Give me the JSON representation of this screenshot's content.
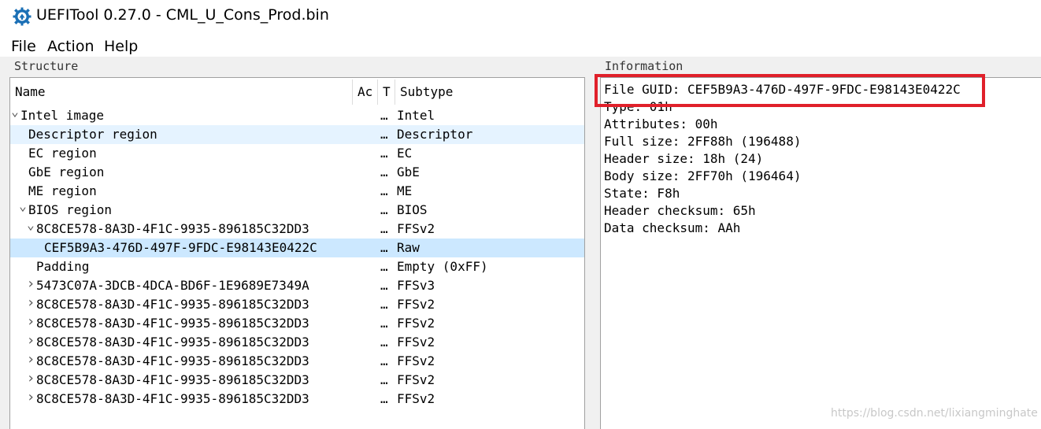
{
  "window": {
    "title": "UEFITool 0.27.0 - CML_U_Cons_Prod.bin",
    "icon": "uefitool-gear-icon",
    "accent": "#1a6fb5"
  },
  "menu": [
    "File",
    "Action",
    "Help"
  ],
  "structure": {
    "group_title": "Structure",
    "columns": [
      "Name",
      "Ac",
      "T",
      "Subtype"
    ],
    "rows": [
      {
        "name": "Intel image",
        "dots": "…",
        "subtype": "Intel",
        "arrow": "expanded"
      },
      {
        "name": "Descriptor region",
        "dots": "…",
        "subtype": "Descriptor",
        "arrow": "none"
      },
      {
        "name": "EC region",
        "dots": "…",
        "subtype": "EC",
        "arrow": "none"
      },
      {
        "name": "GbE region",
        "dots": "…",
        "subtype": "GbE",
        "arrow": "none"
      },
      {
        "name": "ME region",
        "dots": "…",
        "subtype": "ME",
        "arrow": "none"
      },
      {
        "name": "BIOS region",
        "dots": "…",
        "subtype": "BIOS",
        "arrow": "expanded"
      },
      {
        "name": "8C8CE578-8A3D-4F1C-9935-896185C32DD3",
        "dots": "…",
        "subtype": "FFSv2",
        "arrow": "expanded"
      },
      {
        "name": "CEF5B9A3-476D-497F-9FDC-E98143E0422C",
        "dots": "…",
        "subtype": "Raw",
        "arrow": "none"
      },
      {
        "name": "Padding",
        "dots": "…",
        "subtype": "Empty (0xFF)",
        "arrow": "none"
      },
      {
        "name": "5473C07A-3DCB-4DCA-BD6F-1E9689E7349A",
        "dots": "…",
        "subtype": "FFSv3",
        "arrow": "collapsed"
      },
      {
        "name": "8C8CE578-8A3D-4F1C-9935-896185C32DD3",
        "dots": "…",
        "subtype": "FFSv2",
        "arrow": "collapsed"
      },
      {
        "name": "8C8CE578-8A3D-4F1C-9935-896185C32DD3",
        "dots": "…",
        "subtype": "FFSv2",
        "arrow": "collapsed"
      },
      {
        "name": "8C8CE578-8A3D-4F1C-9935-896185C32DD3",
        "dots": "…",
        "subtype": "FFSv2",
        "arrow": "collapsed"
      },
      {
        "name": "8C8CE578-8A3D-4F1C-9935-896185C32DD3",
        "dots": "…",
        "subtype": "FFSv2",
        "arrow": "collapsed"
      },
      {
        "name": "8C8CE578-8A3D-4F1C-9935-896185C32DD3",
        "dots": "…",
        "subtype": "FFSv2",
        "arrow": "collapsed"
      },
      {
        "name": "8C8CE578-8A3D-4F1C-9935-896185C32DD3",
        "dots": "…",
        "subtype": "FFSv2",
        "arrow": "collapsed"
      }
    ]
  },
  "information": {
    "group_title": "Information",
    "lines": [
      "File GUID: CEF5B9A3-476D-497F-9FDC-E98143E0422C",
      "Type: 01h",
      "Attributes: 00h",
      "Full size: 2FF88h (196488)",
      "Header size: 18h (24)",
      "Body size: 2FF70h (196464)",
      "State: F8h",
      "Header checksum: 65h",
      "Data checksum: AAh"
    ],
    "highlight_color": "#e0202a"
  },
  "watermark": "https://blog.csdn.net/lixiangminghate"
}
